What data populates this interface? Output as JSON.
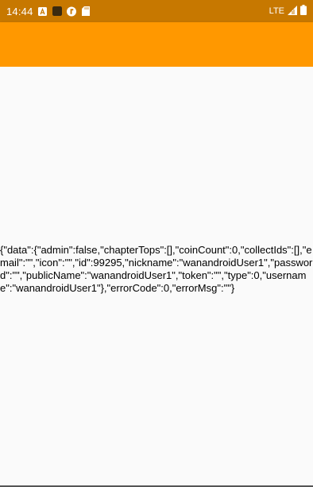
{
  "status_bar": {
    "time": "14:44",
    "network": "LTE",
    "icons": [
      "a-notification-icon",
      "square-notification-icon",
      "flutter-notification-icon",
      "sd-card-icon",
      "signal-icon",
      "battery-icon"
    ],
    "background_color": "#c77800"
  },
  "app_bar": {
    "background_color": "#ff9800"
  },
  "content": {
    "response_text": "{\"data\":{\"admin\":false,\"chapterTops\":[],\"coinCount\":0,\"collectIds\":[],\"email\":\"\",\"icon\":\"\",\"id\":99295,\"nickname\":\"wanandroidUser1\",\"password\":\"\",\"publicName\":\"wanandroidUser1\",\"token\":\"\",\"type\":0,\"username\":\"wanandroidUser1\"},\"errorCode\":0,\"errorMsg\":\"\"}"
  }
}
